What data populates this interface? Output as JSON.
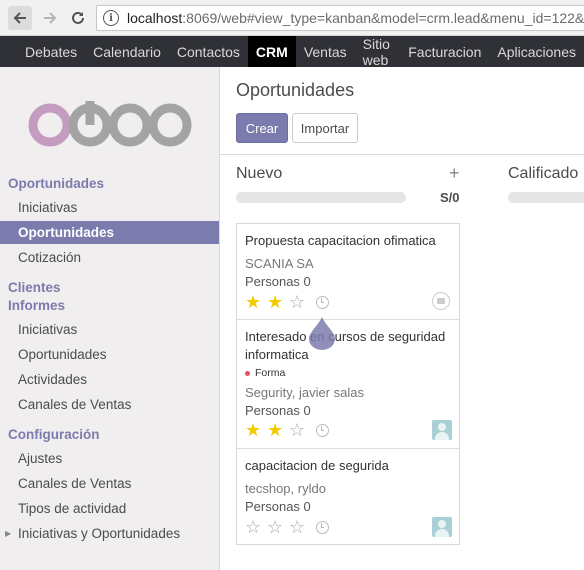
{
  "browser": {
    "url_host": "localhost",
    "url_rest": ":8069/web#view_type=kanban&model=crm.lead&menu_id=122&"
  },
  "topmenu": {
    "items": [
      "Debates",
      "Calendario",
      "Contactos",
      "CRM",
      "Ventas",
      "Sitio web",
      "Facturacion",
      "Aplicaciones"
    ],
    "active": "CRM"
  },
  "sidebar": {
    "sections": [
      {
        "heading": "Oportunidades",
        "items": [
          "Iniciativas",
          "Oportunidades",
          "Cotización"
        ]
      },
      {
        "heading": "Clientes",
        "items": []
      },
      {
        "heading": "Informes",
        "items": [
          "Iniciativas",
          "Oportunidades",
          "Actividades",
          "Canales de Ventas"
        ]
      },
      {
        "heading": "Configuración",
        "items": [
          "Ajustes",
          "Canales de Ventas",
          "Tipos de actividad",
          "Iniciativas y Oportunidades"
        ]
      }
    ],
    "active_item": "Oportunidades"
  },
  "main": {
    "title": "Oportunidades",
    "create_label": "Crear",
    "import_label": "Importar"
  },
  "columns": [
    {
      "name": "Nuevo",
      "add_symbol": "+",
      "total": "S/0"
    },
    {
      "name": "Calificado"
    }
  ],
  "cards": [
    {
      "title": "Propuesta capacitacion ofimatica",
      "customer": "SCANIA SA",
      "revenue": "Personas 0",
      "stars": 2,
      "tag": ""
    },
    {
      "title_line1": "Interesado en cursos de seguridad",
      "title_line2": "informatica",
      "tag": "Forma",
      "customer": "Segurity, javier salas",
      "revenue": "Personas 0",
      "stars": 2
    },
    {
      "title": "capacitacion de segurida",
      "customer": "tecshop, ryldo",
      "revenue": "Personas 0",
      "stars": 0,
      "tag": ""
    }
  ],
  "colors": {
    "brand": "#7c7bad",
    "topbar": "#2f3136",
    "star_on": "#f3cc00",
    "tag_dot": "#e05561"
  },
  "icons": {
    "back": "arrow-left-icon",
    "forward": "arrow-right-icon",
    "reload": "reload-icon",
    "info": "info-icon",
    "clock": "clock-icon",
    "camera": "camera-icon",
    "avatar": "user-avatar-icon"
  }
}
